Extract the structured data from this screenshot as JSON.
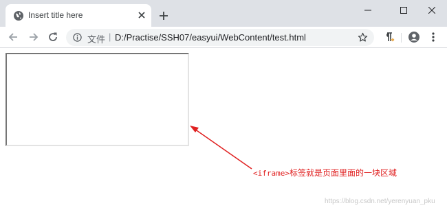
{
  "tab": {
    "title": "Insert title here",
    "favicon": "globe-icon",
    "close_icon": "close-icon"
  },
  "window_controls": [
    "minimize-icon",
    "maximize-icon",
    "close-icon"
  ],
  "toolbar": {
    "back_icon": "back-arrow-icon",
    "forward_icon": "forward-arrow-icon",
    "reload_icon": "reload-icon",
    "info_icon": "info-icon",
    "file_label": "文件",
    "separator": "|",
    "url": "D:/Practise/SSH07/easyui/WebContent/test.html",
    "bookmark_icon": "star-icon",
    "extension_icon": "paragraph-extension-icon",
    "profile_icon": "profile-icon",
    "menu_icon": "three-dot-menu-icon"
  },
  "content": {
    "annotation_code": "<iframe>",
    "annotation_text": "标签就是页面里面的一块区域",
    "annotation_color": "#e02020",
    "watermark": "https://blog.csdn.net/yerenyuan_pku"
  },
  "colors": {
    "tabstrip": "#dee1e6",
    "omnibox": "#f1f3f4",
    "annotation": "#e02020"
  }
}
